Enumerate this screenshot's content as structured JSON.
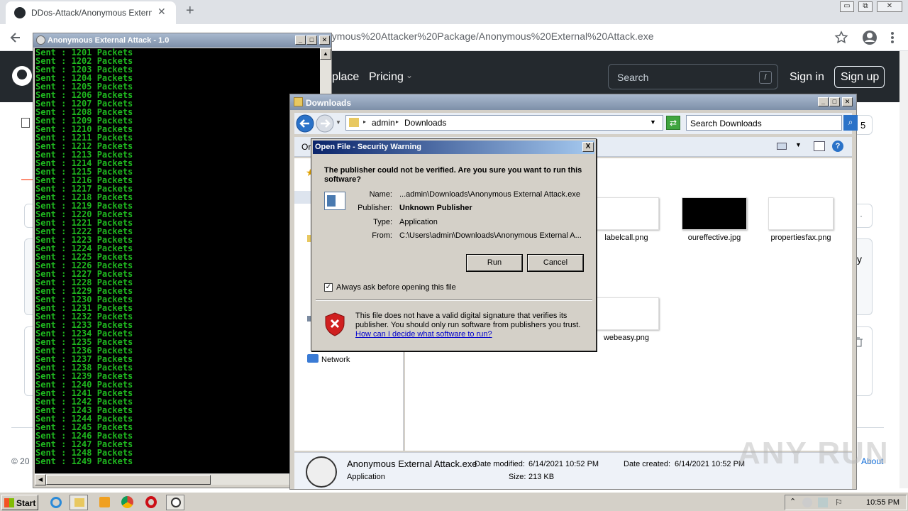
{
  "browser": {
    "tab_title": "DDos-Attack/Anonymous External A",
    "tab_close": "✕",
    "new_tab": "+",
    "address_fragment": "nymous%20Attacker%20Package/Anonymous%20External%20Attack.exe",
    "win_buttons": [
      "▭",
      "⧉",
      "✕"
    ]
  },
  "github": {
    "nav_marketplace": "place",
    "nav_pricing": "Pricing",
    "search_placeholder": "Search",
    "search_key": "/",
    "sign_in": "Sign in",
    "sign_up": "Sign up",
    "count_badge": "5",
    "side_text": "y",
    "footer_left": "© 20",
    "footer_right": "About"
  },
  "console": {
    "title": "Anonymous External Attack - 1.0",
    "lines": [
      "Sent : 1201 Packets",
      "Sent : 1202 Packets",
      "Sent : 1203 Packets",
      "Sent : 1204 Packets",
      "Sent : 1205 Packets",
      "Sent : 1206 Packets",
      "Sent : 1207 Packets",
      "Sent : 1208 Packets",
      "Sent : 1209 Packets",
      "Sent : 1210 Packets",
      "Sent : 1211 Packets",
      "Sent : 1212 Packets",
      "Sent : 1213 Packets",
      "Sent : 1214 Packets",
      "Sent : 1215 Packets",
      "Sent : 1216 Packets",
      "Sent : 1217 Packets",
      "Sent : 1218 Packets",
      "Sent : 1219 Packets",
      "Sent : 1220 Packets",
      "Sent : 1221 Packets",
      "Sent : 1222 Packets",
      "Sent : 1223 Packets",
      "Sent : 1224 Packets",
      "Sent : 1225 Packets",
      "Sent : 1226 Packets",
      "Sent : 1227 Packets",
      "Sent : 1228 Packets",
      "Sent : 1229 Packets",
      "Sent : 1230 Packets",
      "Sent : 1231 Packets",
      "Sent : 1232 Packets",
      "Sent : 1233 Packets",
      "Sent : 1234 Packets",
      "Sent : 1235 Packets",
      "Sent : 1236 Packets",
      "Sent : 1237 Packets",
      "Sent : 1238 Packets",
      "Sent : 1239 Packets",
      "Sent : 1240 Packets",
      "Sent : 1241 Packets",
      "Sent : 1242 Packets",
      "Sent : 1243 Packets",
      "Sent : 1244 Packets",
      "Sent : 1245 Packets",
      "Sent : 1246 Packets",
      "Sent : 1247 Packets",
      "Sent : 1248 Packets",
      "Sent : 1249 Packets"
    ]
  },
  "explorer": {
    "title": "Downloads",
    "breadcrumb_1": "admin",
    "breadcrumb_2": "Downloads",
    "search_placeholder": "Search Downloads",
    "organize": "Or",
    "nav_network": "Network",
    "files": [
      {
        "name": "labelcall.png"
      },
      {
        "name": "oureffective.jpg"
      },
      {
        "name": "propertiesfax.png"
      },
      {
        "name": "webeasy.png"
      }
    ],
    "details": {
      "name": "Anonymous External Attack.exe",
      "type": "Application",
      "modified_label": "Date modified:",
      "modified_value": "6/14/2021 10:52 PM",
      "created_label": "Date created:",
      "created_value": "6/14/2021 10:52 PM",
      "size_label": "Size:",
      "size_value": "213 KB"
    }
  },
  "dialog": {
    "title": "Open File - Security Warning",
    "close": "X",
    "question": "The publisher could not be verified.  Are you sure you want to run this software?",
    "name_label": "Name:",
    "name_value": "...admin\\Downloads\\Anonymous External Attack.exe",
    "publisher_label": "Publisher:",
    "publisher_value": "Unknown Publisher",
    "type_label": "Type:",
    "type_value": "Application",
    "from_label": "From:",
    "from_value": "C:\\Users\\admin\\Downloads\\Anonymous External A...",
    "run": "Run",
    "cancel": "Cancel",
    "always_ask": "Always ask before opening this file",
    "always_ask_checked": true,
    "warning_text": "This file does not have a valid digital signature that verifies its publisher.  You should only run software from publishers you trust.",
    "help_link": "How can I decide what software to run?"
  },
  "taskbar": {
    "start": "Start",
    "clock": "10:55 PM"
  },
  "watermark": "ANY RUN"
}
